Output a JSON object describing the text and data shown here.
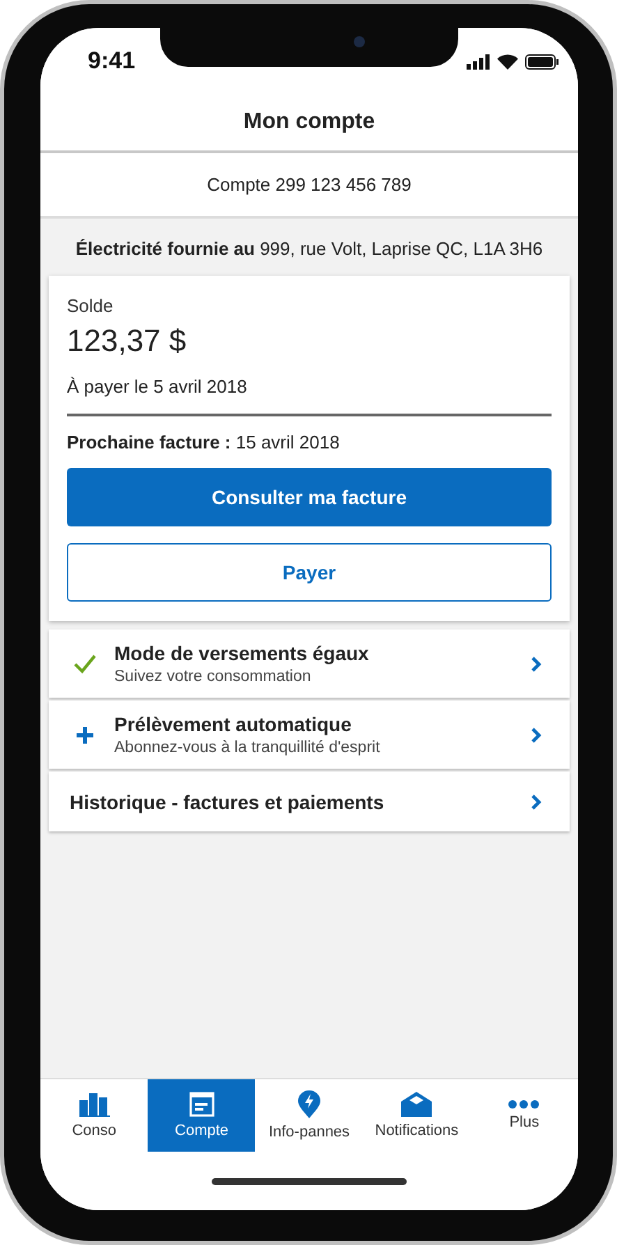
{
  "status_bar": {
    "time": "9:41"
  },
  "header": {
    "title": "Mon compte"
  },
  "account": {
    "label": "Compte 299 123 456 789"
  },
  "address": "**Électricité fournie au** 999, rue Volt, Laprise QC, L1A 3H6",
  "balance_card": {
    "label": "Solde",
    "amount": "123,37 $",
    "due": "À payer le 5 avril 2018",
    "next_bill": "**Prochaine facture :** 15 avril 2018",
    "primary_button": "Consulter ma facture",
    "secondary_button": "Payer"
  },
  "options": [
    {
      "kind": "check",
      "title": "Mode de versements égaux",
      "subtitle": "Suivez votre consommation"
    },
    {
      "kind": "plus",
      "title": "Prélèvement automatique",
      "subtitle": "Abonnez-vous à la tranquillité d'esprit"
    },
    {
      "kind": "plain",
      "title": "Historique - factures et paiements"
    }
  ],
  "tabs": [
    {
      "kind": "chart",
      "label": "Conso",
      "selected": false
    },
    {
      "kind": "bill",
      "label": "Compte",
      "selected": true
    },
    {
      "kind": "outage",
      "label": "Info-pannes",
      "selected": false
    },
    {
      "kind": "mail",
      "label": "Notifications",
      "selected": false
    },
    {
      "kind": "more",
      "label": "Plus",
      "selected": false
    }
  ]
}
